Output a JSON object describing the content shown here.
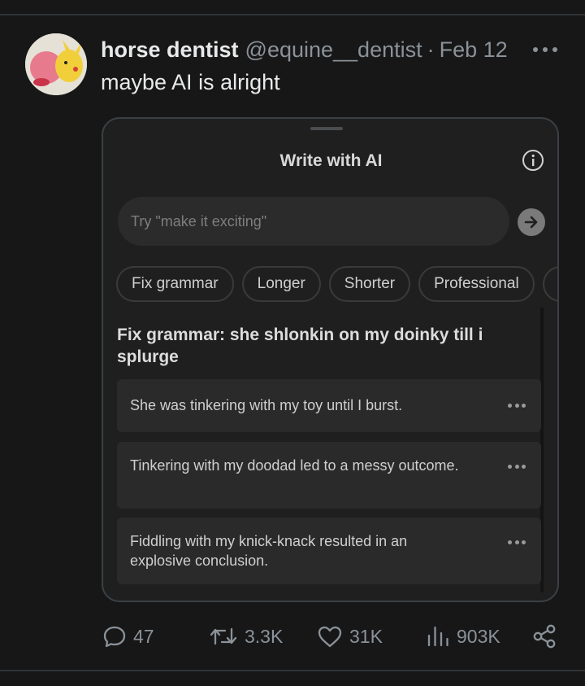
{
  "tweet": {
    "author_name": "horse dentist",
    "handle": "@equine__dentist",
    "separator": "·",
    "date": "Feb 12",
    "text": "maybe AI is alright"
  },
  "ai_panel": {
    "title": "Write with AI",
    "input_placeholder": "Try \"make it exciting\"",
    "chips": [
      "Fix grammar",
      "Longer",
      "Shorter",
      "Professional"
    ],
    "heading": "Fix grammar: she shlonkin on my doinky till i splurge",
    "results": [
      "She was tinkering with my toy until I burst.",
      "Tinkering with my doodad led to a messy outcome.",
      "Fiddling with my knick-knack resulted in an explosive conclusion."
    ]
  },
  "engagement": {
    "replies": "47",
    "reposts": "3.3K",
    "likes": "31K",
    "views": "903K"
  },
  "icons": {
    "more": "more-icon",
    "info": "info-icon",
    "send": "arrow-right-icon",
    "reply": "reply-icon",
    "repost": "repost-icon",
    "like": "heart-icon",
    "views": "views-icon",
    "share": "share-icon"
  }
}
